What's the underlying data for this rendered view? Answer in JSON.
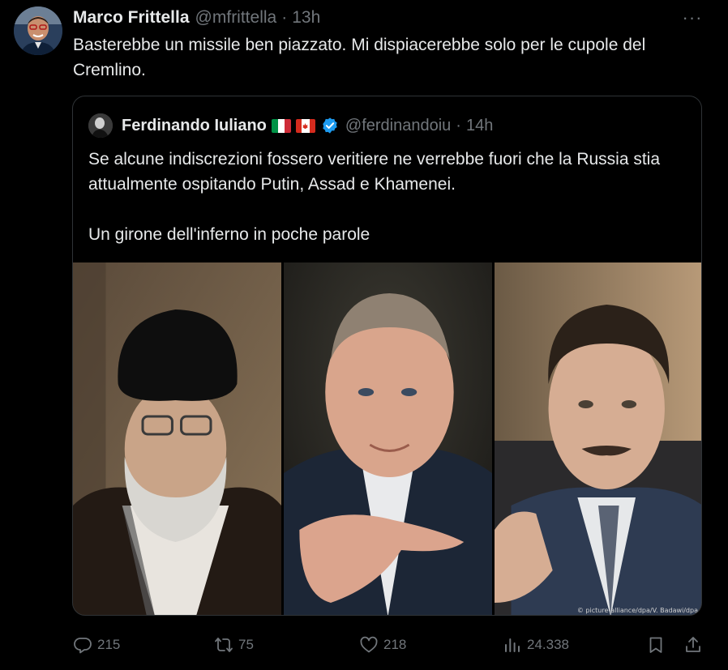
{
  "tweet": {
    "author_name": "Marco Frittella",
    "author_handle": "@mfrittella",
    "separator": "·",
    "time": "13h",
    "more_label": "···",
    "text": "Basterebbe un missile ben piazzato. Mi dispiacerebbe solo per le cupole del Cremlino."
  },
  "quote": {
    "author_name": "Ferdinando Iuliano",
    "author_handle": "@ferdinandoiu",
    "separator": "·",
    "time": "14h",
    "paragraph_1": "Se alcune indiscrezioni fossero veritiere ne verrebbe fuori che la Russia stia attualmente ospitando Putin, Assad e Khamenei.",
    "paragraph_2": "Un girone dell'inferno in poche parole",
    "flags": [
      "italy-flag",
      "canada-flag"
    ],
    "image_credit": "© picture-alliance/dpa/V. Badawi/dpa"
  },
  "actions": {
    "reply_count": "215",
    "repost_count": "75",
    "like_count": "218",
    "views_count": "24.338"
  },
  "icons": {
    "reply": "reply-icon",
    "repost": "repost-icon",
    "like": "heart-icon",
    "views": "views-icon",
    "bookmark": "bookmark-icon",
    "share": "share-icon",
    "verified": "verified-badge-icon"
  },
  "colors": {
    "background": "#000000",
    "text_primary": "#e7e9ea",
    "text_secondary": "#71767b",
    "border": "#2f3336",
    "verified": "#1d9bf0"
  }
}
